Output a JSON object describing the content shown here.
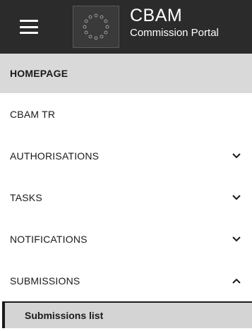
{
  "header": {
    "title": "CBAM",
    "subtitle": "Commission Portal",
    "menu_icon": "hamburger-menu-icon",
    "logo_icon": "eu-flag-icon"
  },
  "menu": {
    "items": [
      {
        "label": "HOMEPAGE",
        "active": true
      },
      {
        "label": "CBAM TR"
      },
      {
        "label": "AUTHORISATIONS",
        "chevron": "chevron-down-icon"
      },
      {
        "label": "TASKS",
        "chevron": "chevron-down-icon"
      },
      {
        "label": "NOTIFICATIONS",
        "chevron": "chevron-down-icon"
      },
      {
        "label": "SUBMISSIONS",
        "chevron": "chevron-up-icon",
        "expanded": true
      }
    ],
    "submenu": {
      "submissions": [
        "Submissions list"
      ]
    }
  },
  "colors": {
    "header_bg": "#2b2b2b",
    "active_bg": "#d9d9d9",
    "submenu_bg": "#d4d4d4"
  }
}
